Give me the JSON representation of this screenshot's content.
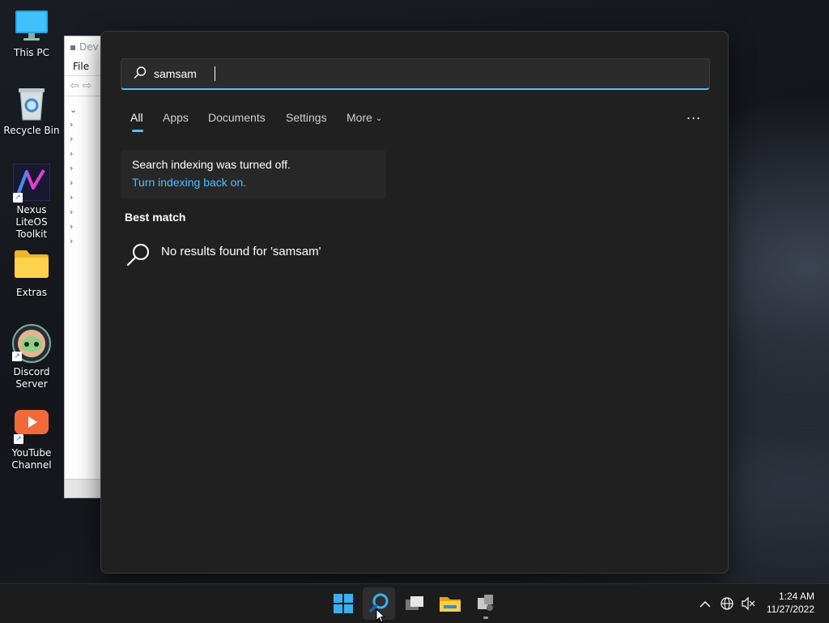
{
  "desktop": {
    "icons": [
      {
        "label": "This PC",
        "icon": "monitor-icon"
      },
      {
        "label": "Recycle Bin",
        "icon": "recycle-bin-icon"
      },
      {
        "label": "Nexus LiteOS Toolkit",
        "icon": "nexus-toolkit-icon"
      },
      {
        "label": "Extras",
        "icon": "folder-icon"
      },
      {
        "label": "Discord Server",
        "icon": "discord-icon"
      },
      {
        "label": "YouTube Channel",
        "icon": "youtube-icon"
      }
    ]
  },
  "background_window": {
    "title": "Dev",
    "menu": "File"
  },
  "search": {
    "query": "samsam",
    "tabs": [
      {
        "label": "All",
        "active": true
      },
      {
        "label": "Apps"
      },
      {
        "label": "Documents"
      },
      {
        "label": "Settings"
      },
      {
        "label": "More"
      }
    ],
    "more_options": "...",
    "notice_text": "Search indexing was turned off.",
    "notice_link": "Turn indexing back on.",
    "best_match_heading": "Best match",
    "no_results_text": "No results found for 'samsam'"
  },
  "taskbar": {
    "apps": [
      "start-icon",
      "search-icon",
      "task-view-icon",
      "file-explorer-icon",
      "device-manager-icon"
    ],
    "time": "1:24 AM",
    "date": "11/27/2022"
  },
  "colors": {
    "accent": "#4cc2ff",
    "panel_bg": "#202020",
    "taskbar_bg": "#1c1c1c"
  }
}
